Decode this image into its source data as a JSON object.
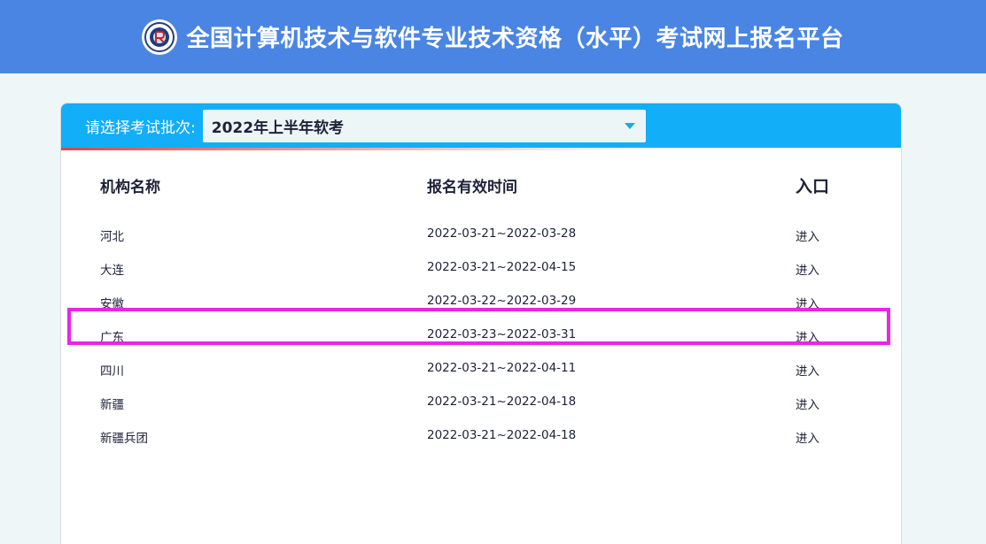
{
  "header": {
    "title": "全国计算机技术与软件专业技术资格（水平）考试网上报名平台",
    "logo_icon": "exam-logo-icon"
  },
  "selector": {
    "label": "请选择考试批次:",
    "selected": "2022年上半年软考"
  },
  "table": {
    "columns": [
      "机构名称",
      "报名有效时间",
      "入口"
    ],
    "rows": [
      {
        "name": "河北",
        "period": "2022-03-21~2022-03-28",
        "action": "进入"
      },
      {
        "name": "大连",
        "period": "2022-03-21~2022-04-15",
        "action": "进入"
      },
      {
        "name": "安徽",
        "period": "2022-03-22~2022-03-29",
        "action": "进入"
      },
      {
        "name": "广东",
        "period": "2022-03-23~2022-03-31",
        "action": "进入"
      },
      {
        "name": "四川",
        "period": "2022-03-21~2022-04-11",
        "action": "进入"
      },
      {
        "name": "新疆",
        "period": "2022-03-21~2022-04-18",
        "action": "进入"
      },
      {
        "name": "新疆兵团",
        "period": "2022-03-21~2022-04-18",
        "action": "进入"
      }
    ]
  },
  "colors": {
    "header_bg": "#4a85e4",
    "bar_bg": "#12aef7",
    "highlight": "#e826e6"
  }
}
